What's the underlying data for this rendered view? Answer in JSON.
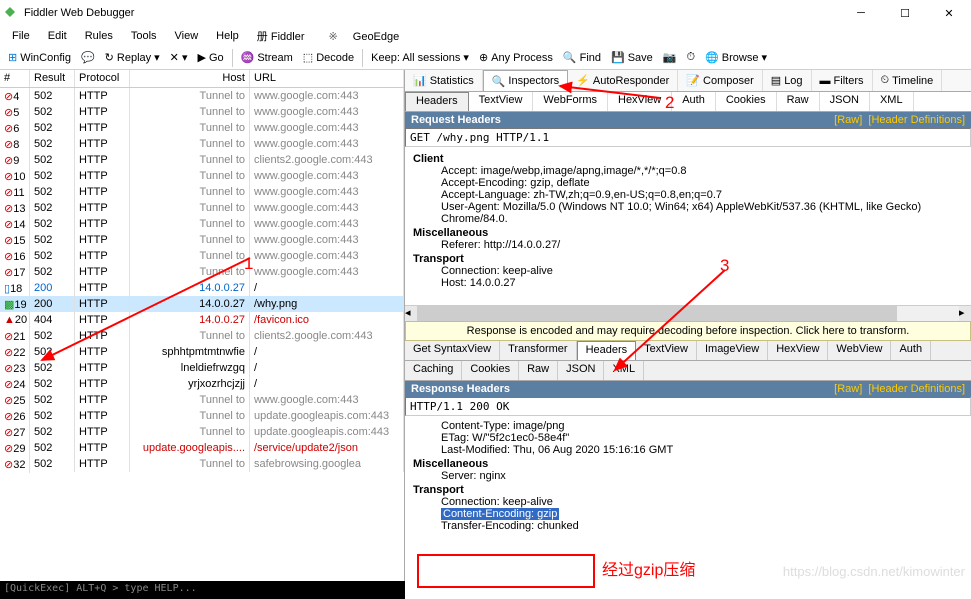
{
  "window": {
    "title": "Fiddler Web Debugger"
  },
  "menu": [
    "File",
    "Edit",
    "Rules",
    "Tools",
    "View",
    "Help",
    "册 Fiddler",
    "GeoEdge"
  ],
  "toolbar": {
    "winconfig": "WinConfig",
    "replay": "Replay",
    "go": "Go",
    "stream": "Stream",
    "decode": "Decode",
    "keep": "Keep: All sessions",
    "anyprocess": "Any Process",
    "find": "Find",
    "save": "Save",
    "browse": "Browse"
  },
  "grid": {
    "cols": {
      "num": "#",
      "result": "Result",
      "protocol": "Protocol",
      "host": "Host",
      "url": "URL"
    },
    "rows": [
      {
        "n": "4",
        "r": "502",
        "p": "HTTP",
        "h": "Tunnel to",
        "u": "www.google.com:443",
        "icon": "block"
      },
      {
        "n": "5",
        "r": "502",
        "p": "HTTP",
        "h": "Tunnel to",
        "u": "www.google.com:443",
        "icon": "block"
      },
      {
        "n": "6",
        "r": "502",
        "p": "HTTP",
        "h": "Tunnel to",
        "u": "www.google.com:443",
        "icon": "block"
      },
      {
        "n": "8",
        "r": "502",
        "p": "HTTP",
        "h": "Tunnel to",
        "u": "www.google.com:443",
        "icon": "block"
      },
      {
        "n": "9",
        "r": "502",
        "p": "HTTP",
        "h": "Tunnel to",
        "u": "clients2.google.com:443",
        "icon": "block"
      },
      {
        "n": "10",
        "r": "502",
        "p": "HTTP",
        "h": "Tunnel to",
        "u": "www.google.com:443",
        "icon": "block"
      },
      {
        "n": "11",
        "r": "502",
        "p": "HTTP",
        "h": "Tunnel to",
        "u": "www.google.com:443",
        "icon": "block"
      },
      {
        "n": "13",
        "r": "502",
        "p": "HTTP",
        "h": "Tunnel to",
        "u": "www.google.com:443",
        "icon": "block"
      },
      {
        "n": "14",
        "r": "502",
        "p": "HTTP",
        "h": "Tunnel to",
        "u": "www.google.com:443",
        "icon": "block"
      },
      {
        "n": "15",
        "r": "502",
        "p": "HTTP",
        "h": "Tunnel to",
        "u": "www.google.com:443",
        "icon": "block"
      },
      {
        "n": "16",
        "r": "502",
        "p": "HTTP",
        "h": "Tunnel to",
        "u": "www.google.com:443",
        "icon": "block"
      },
      {
        "n": "17",
        "r": "502",
        "p": "HTTP",
        "h": "Tunnel to",
        "u": "www.google.com:443",
        "icon": "block"
      },
      {
        "n": "18",
        "r": "200",
        "p": "HTTP",
        "h": "14.0.0.27",
        "u": "/",
        "icon": "page",
        "blue": true
      },
      {
        "n": "19",
        "r": "200",
        "p": "HTTP",
        "h": "14.0.0.27",
        "u": "/why.png",
        "icon": "img",
        "sel": true
      },
      {
        "n": "20",
        "r": "404",
        "p": "HTTP",
        "h": "14.0.0.27",
        "u": "/favicon.ico",
        "icon": "warn",
        "red": true
      },
      {
        "n": "21",
        "r": "502",
        "p": "HTTP",
        "h": "Tunnel to",
        "u": "clients2.google.com:443",
        "icon": "block"
      },
      {
        "n": "22",
        "r": "502",
        "p": "HTTP",
        "h": "sphhtpmtmtnwfie",
        "u": "/",
        "icon": "block"
      },
      {
        "n": "23",
        "r": "502",
        "p": "HTTP",
        "h": "lneldiefrwzgq",
        "u": "/",
        "icon": "block"
      },
      {
        "n": "24",
        "r": "502",
        "p": "HTTP",
        "h": "yrjxozrhcjzjj",
        "u": "/",
        "icon": "block"
      },
      {
        "n": "25",
        "r": "502",
        "p": "HTTP",
        "h": "Tunnel to",
        "u": "www.google.com:443",
        "icon": "block"
      },
      {
        "n": "26",
        "r": "502",
        "p": "HTTP",
        "h": "Tunnel to",
        "u": "update.googleapis.com:443",
        "icon": "block"
      },
      {
        "n": "27",
        "r": "502",
        "p": "HTTP",
        "h": "Tunnel to",
        "u": "update.googleapis.com:443",
        "icon": "block"
      },
      {
        "n": "29",
        "r": "502",
        "p": "HTTP",
        "h": "update.googleapis....",
        "u": "/service/update2/json",
        "icon": "block",
        "red": true
      },
      {
        "n": "32",
        "r": "502",
        "p": "HTTP",
        "h": "Tunnel to",
        "u": "safebrowsing.googlea",
        "icon": "block"
      }
    ]
  },
  "tabs1": [
    "Statistics",
    "Inspectors",
    "AutoResponder",
    "Composer",
    "Log",
    "Filters",
    "Timeline"
  ],
  "tabs1_active": 1,
  "req_subtabs": [
    "Headers",
    "TextView",
    "WebForms",
    "HexView",
    "Auth",
    "Cookies",
    "Raw",
    "JSON",
    "XML"
  ],
  "req_subtabs_active": 0,
  "req": {
    "title": "Request Headers",
    "raw": "[Raw]",
    "defs": "[Header Definitions]",
    "line": "GET /why.png HTTP/1.1",
    "groups": [
      {
        "name": "Client",
        "items": [
          "Accept: image/webp,image/apng,image/*,*/*;q=0.8",
          "Accept-Encoding: gzip, deflate",
          "Accept-Language: zh-TW,zh;q=0.9,en-US;q=0.8,en;q=0.7",
          "User-Agent: Mozilla/5.0 (Windows NT 10.0; Win64; x64) AppleWebKit/537.36 (KHTML, like Gecko) Chrome/84.0."
        ]
      },
      {
        "name": "Miscellaneous",
        "items": [
          "Referer: http://14.0.0.27/"
        ]
      },
      {
        "name": "Transport",
        "items": [
          "Connection: keep-alive",
          "Host: 14.0.0.27"
        ]
      }
    ]
  },
  "decode_bar": "Response is encoded and may require decoding before inspection. Click here to transform.",
  "resp_subtabs1": [
    "Get SyntaxView",
    "Transformer",
    "Headers",
    "TextView",
    "ImageView",
    "HexView",
    "WebView",
    "Auth"
  ],
  "resp_subtabs1_active": 2,
  "resp_subtabs2": [
    "Caching",
    "Cookies",
    "Raw",
    "JSON",
    "XML"
  ],
  "resp": {
    "title": "Response Headers",
    "raw": "[Raw]",
    "defs": "[Header Definitions]",
    "line": "HTTP/1.1 200 OK",
    "groups": [
      {
        "name": "",
        "items": [
          "Content-Type: image/png",
          "ETag: W/\"5f2c1ec0-58e4f\"",
          "Last-Modified: Thu, 06 Aug 2020 15:16:16 GMT"
        ]
      },
      {
        "name": "Miscellaneous",
        "items": [
          "Server: nginx"
        ]
      },
      {
        "name": "Transport",
        "items": [
          "Connection: keep-alive",
          "Content-Encoding: gzip",
          "Transfer-Encoding: chunked"
        ]
      }
    ]
  },
  "anno": {
    "one": "1",
    "two": "2",
    "three": "3",
    "gzip": "经过gzip压缩"
  },
  "quickexec": "[QuickExec] ALT+Q > type HELP...",
  "watermark": "https://blog.csdn.net/kimowinter"
}
